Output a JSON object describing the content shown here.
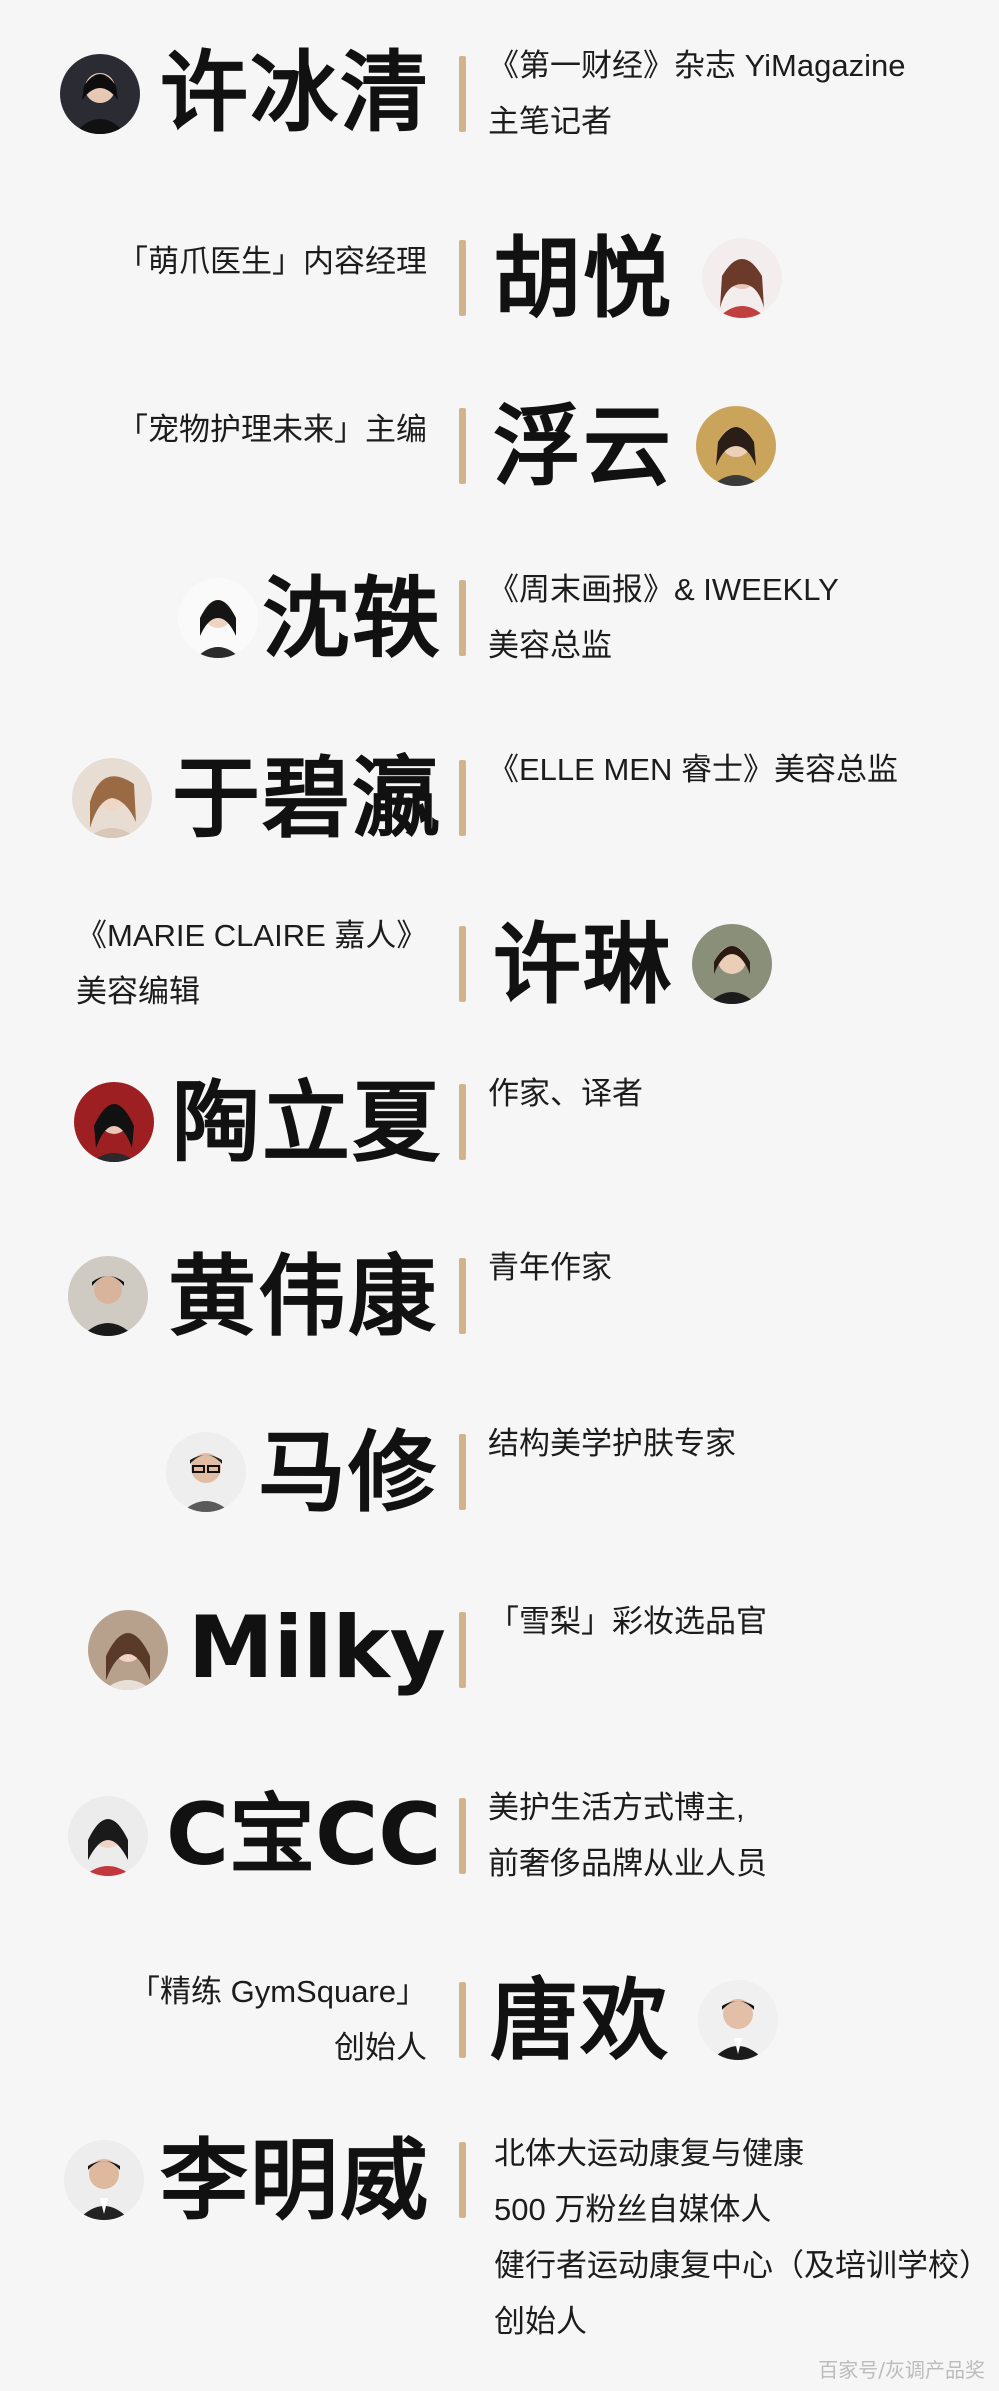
{
  "people": [
    {
      "name": "许冰清",
      "desc": [
        "《第一财经》杂志 YiMagazine",
        "主笔记者"
      ]
    },
    {
      "name": "胡悦",
      "desc": [
        "「萌爪医生」内容经理"
      ]
    },
    {
      "name": "浮云",
      "desc": [
        "「宠物护理未来」主编"
      ]
    },
    {
      "name": "沈轶",
      "desc": [
        "《周末画报》& IWEEKLY",
        "美容总监"
      ]
    },
    {
      "name": "于碧瀛",
      "desc": [
        "《ELLE MEN 睿士》美容总监"
      ]
    },
    {
      "name": "许琳",
      "desc": [
        "《MARIE CLAIRE 嘉人》",
        "美容编辑"
      ]
    },
    {
      "name": "陶立夏",
      "desc": [
        "作家、译者"
      ]
    },
    {
      "name": "黄伟康",
      "desc": [
        "青年作家"
      ]
    },
    {
      "name": "马修",
      "desc": [
        "结构美学护肤专家"
      ]
    },
    {
      "name": "Milky",
      "desc": [
        "「雪梨」彩妆选品官"
      ]
    },
    {
      "name": "C宝CC",
      "desc": [
        "美护生活方式博主,",
        "前奢侈品牌从业人员"
      ]
    },
    {
      "name": "唐欢",
      "desc": [
        "「精练 GymSquare」",
        "创始人"
      ]
    },
    {
      "name": "李明威",
      "desc": [
        "北体大运动康复与健康",
        "500 万粉丝自媒体人",
        "健行者运动康复中心（及培训学校）",
        "创始人"
      ]
    }
  ],
  "watermark": "百家号/灰调产品奖",
  "colors": {
    "accent_bar": "#d2b48c",
    "background": "#f6f6f6"
  }
}
